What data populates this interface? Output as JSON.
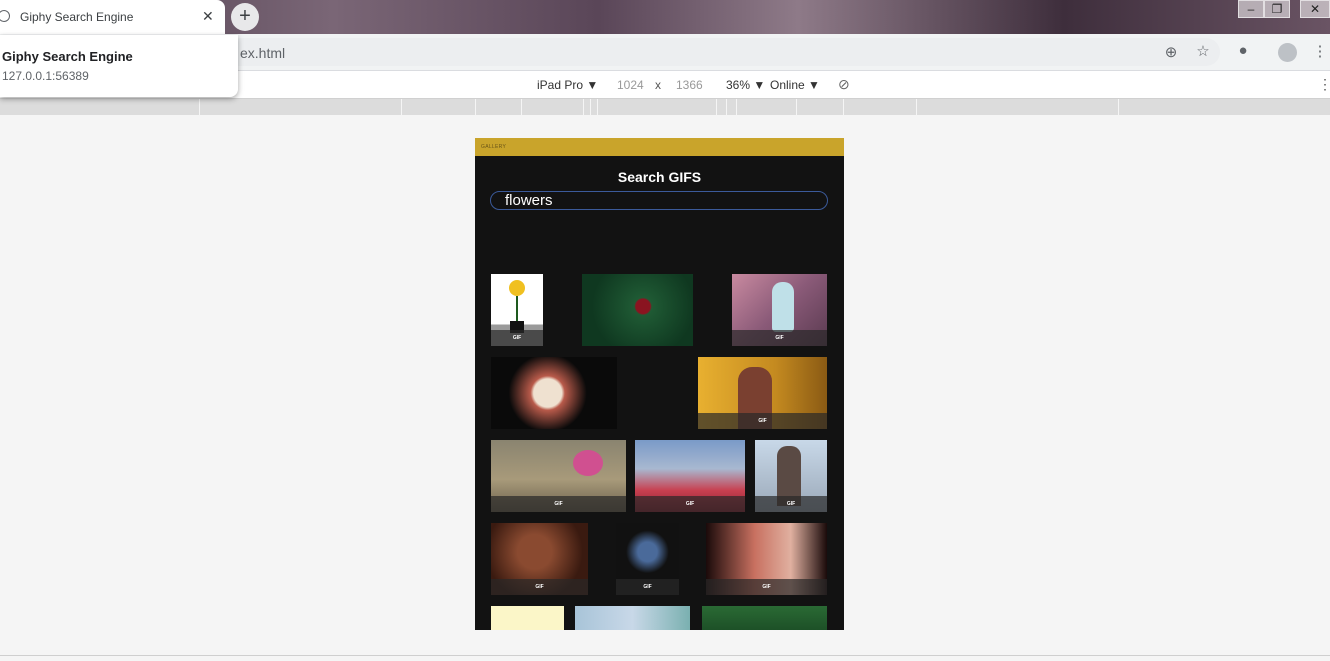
{
  "browser": {
    "tab_title": "Giphy Search Engine",
    "new_tab_label": "+",
    "close_label": "✕",
    "url_fragment": "ex.html",
    "window_controls": [
      "–",
      "❐",
      "✕"
    ]
  },
  "popup": {
    "title": "Giphy Search Engine",
    "url": "127.0.0.1:56389"
  },
  "device_toolbar": {
    "device": "iPad Pro ▼",
    "width": "1024",
    "times": "x",
    "height": "1366",
    "zoom": "36% ▼",
    "network": "Online ▼"
  },
  "app": {
    "header_label": "GALLERY",
    "heading": "Search GIFS",
    "search_value": "flowers",
    "gif_label": "GIF"
  },
  "colors": {
    "accent_bar": "#c9a42b",
    "page_bg": "#121212",
    "search_border": "#3b5a9a"
  }
}
